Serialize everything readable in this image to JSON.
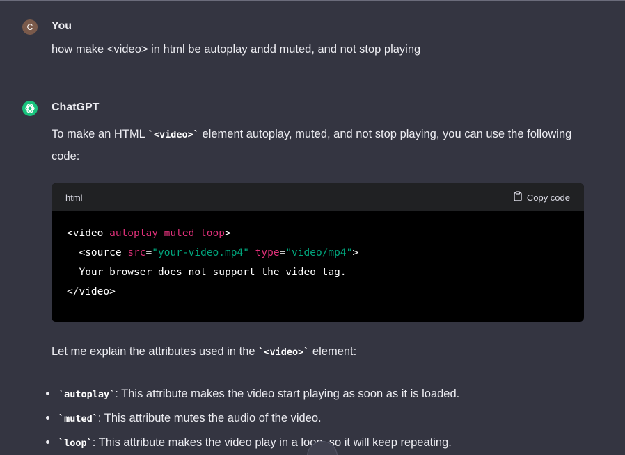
{
  "user": {
    "avatar_letter": "C",
    "name": "You",
    "message": "how make <video> in html be autoplay andd muted, and not stop playing"
  },
  "assistant": {
    "name": "ChatGPT",
    "intro_before": "To make an HTML ",
    "intro_code": "`<video>`",
    "intro_after": " element autoplay, muted, and not stop playing, you can use the following code:",
    "code_block": {
      "language": "html",
      "copy_label": "Copy code",
      "lines": [
        "<video autoplay muted loop>",
        "  <source src=\"your-video.mp4\" type=\"video/mp4\">",
        "  Your browser does not support the video tag.",
        "</video>"
      ]
    },
    "explain_before": "Let me explain the attributes used in the ",
    "explain_code": "`<video>`",
    "explain_after": " element:",
    "bullets": [
      {
        "code": "`autoplay`",
        "text": ": This attribute makes the video start playing as soon as it is loaded."
      },
      {
        "code": "`muted`",
        "text": ": This attribute mutes the audio of the video."
      },
      {
        "code": "`loop`",
        "text": ": This attribute makes the video play in a loop, so it will keep repeating."
      }
    ]
  },
  "colors": {
    "background": "#343541",
    "gpt_green": "#19c37d",
    "code_bg": "#000000",
    "attr_pink": "#df3079",
    "string_green": "#00a67d"
  },
  "icons": [
    "clipboard-icon",
    "openai-logo-icon",
    "scroll-down-icon"
  ]
}
